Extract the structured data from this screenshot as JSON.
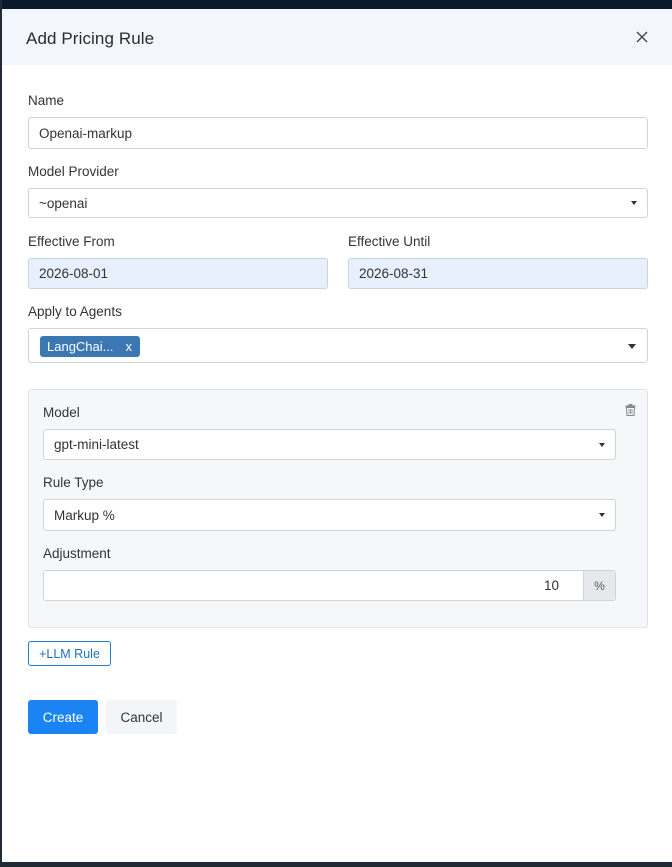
{
  "dialog": {
    "title": "Add Pricing Rule",
    "close_icon": "close-icon"
  },
  "form": {
    "name": {
      "label": "Name",
      "value": "Openai-markup"
    },
    "model_provider": {
      "label": "Model Provider",
      "value": "~openai"
    },
    "effective_from": {
      "label": "Effective From",
      "value": "2026-08-01"
    },
    "effective_until": {
      "label": "Effective Until",
      "value": "2026-08-31"
    },
    "apply_to_agents": {
      "label": "Apply to Agents",
      "tags": [
        {
          "label": "LangChai...",
          "remove": "x"
        }
      ]
    }
  },
  "rule": {
    "delete_icon": "trash-icon",
    "model": {
      "label": "Model",
      "value": "gpt-mini-latest"
    },
    "rule_type": {
      "label": "Rule Type",
      "value": "Markup %"
    },
    "adjustment": {
      "label": "Adjustment",
      "value": "10",
      "unit": "%"
    }
  },
  "actions": {
    "add_llm_rule": "+LLM Rule",
    "create": "Create",
    "cancel": "Cancel"
  },
  "colors": {
    "primary": "#1a84f5",
    "tag": "#3a77b3",
    "date_bg": "#e8f0fe",
    "header_bg": "#f3f7fd"
  }
}
